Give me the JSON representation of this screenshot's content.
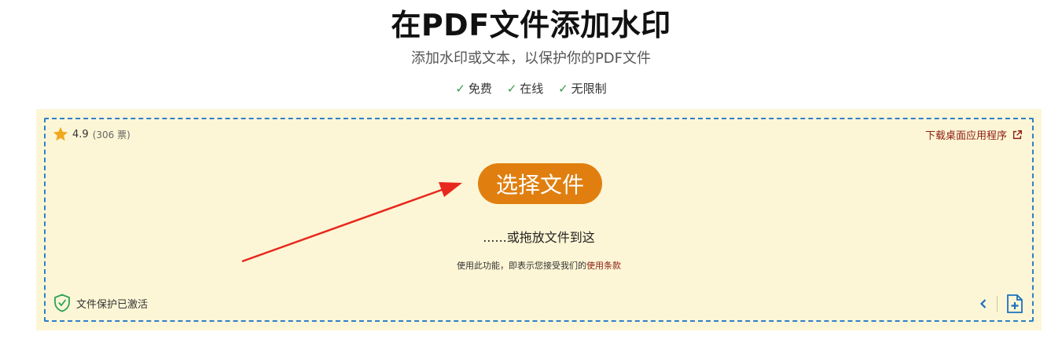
{
  "header": {
    "title": "在PDF文件添加水印",
    "subtitle": "添加水印或文本，以保护你的PDF文件",
    "features": [
      {
        "label": "免费"
      },
      {
        "label": "在线"
      },
      {
        "label": "无限制"
      }
    ],
    "check_mark": "✓"
  },
  "upload": {
    "rating_score": "4.9",
    "rating_votes": "(306 票)",
    "desktop_link": "下载桌面应用程序",
    "select_button": "选择文件",
    "drop_text": "......或拖放文件到这",
    "terms_prefix": "使用此功能，即表示您接受我们的",
    "terms_link": "使用条款",
    "protection_status": "文件保护已激活"
  },
  "icons": {
    "star": "star-icon",
    "external_link": "external-link-icon",
    "shield": "shield-check-icon",
    "chevron": "chevron-left-icon",
    "add_file": "add-file-icon"
  },
  "colors": {
    "accent_button": "#e07f10",
    "dropzone_bg": "#fdf6d6",
    "dropzone_border": "#2f7fc8",
    "link": "#8b1c12",
    "check": "#3a9a4a",
    "annotation_arrow": "#e8281e"
  }
}
